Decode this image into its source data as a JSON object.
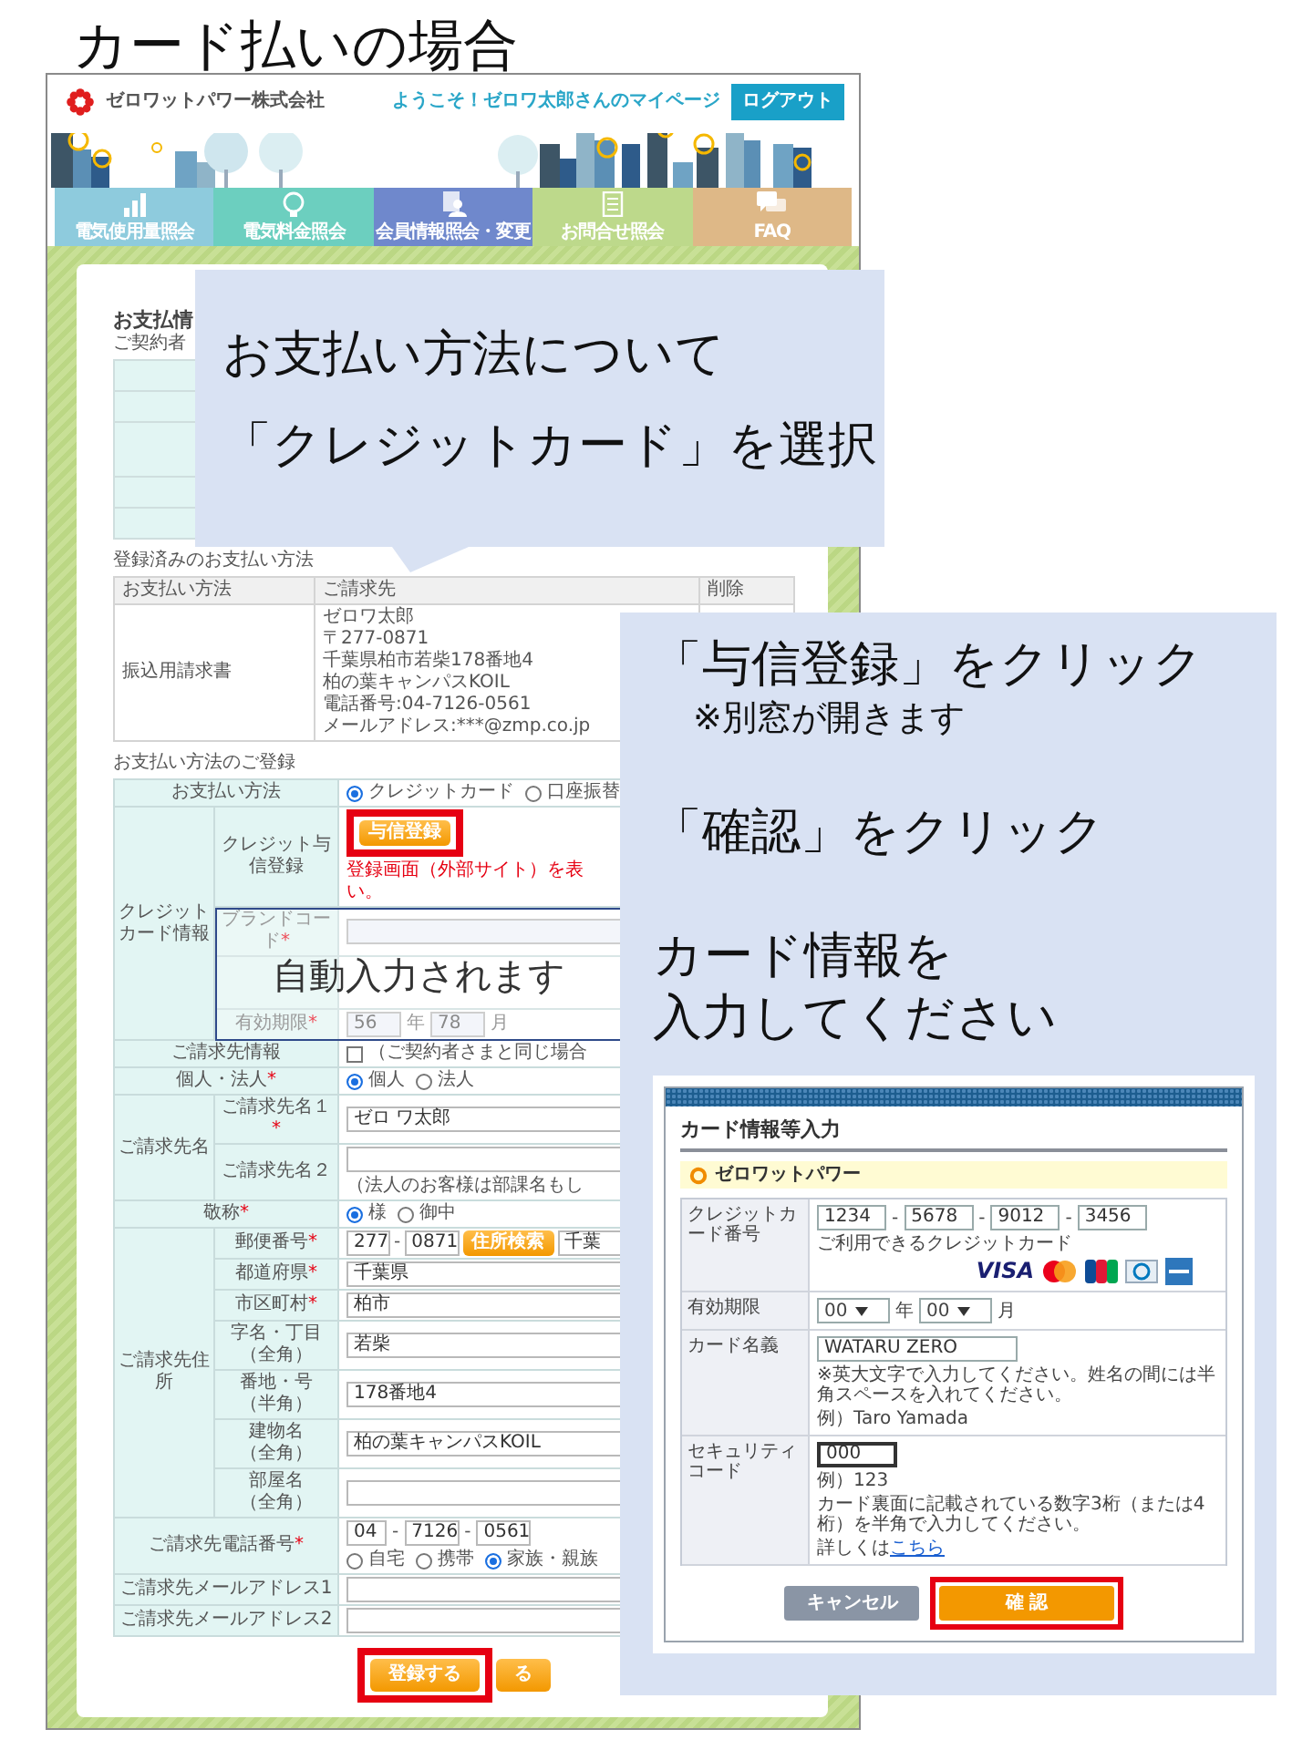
{
  "title": "カード払いの場合",
  "site": {
    "logo_text": "ゼロワットパワー株式会社",
    "welcome": "ようこそ！ゼロワ太郎さんのマイページ",
    "logout": "ログアウト",
    "nav": [
      {
        "label": "電気使用量照会",
        "color": "#8ecbdd",
        "kind": "chart"
      },
      {
        "label": "電気料金照会",
        "color": "#6ccfbf",
        "kind": "bulb"
      },
      {
        "label": "会員情報照会・変更",
        "color": "#6f88cc",
        "kind": "member"
      },
      {
        "label": "お問合せ照会",
        "color": "#bdd98b",
        "kind": "document"
      },
      {
        "label": "FAQ",
        "color": "#deb887",
        "kind": "chat"
      }
    ],
    "page_title": "お支払情",
    "page_subtitle": "ご契約者",
    "registered": {
      "label": "登録済みのお支払い方法",
      "columns": [
        "お支払い方法",
        "ご請求先",
        "削除"
      ],
      "rows": [
        {
          "method": "振込用請求書",
          "lines": [
            "ゼロワ太郎",
            "〒277-0871",
            "千葉県柏市若柴178番地4",
            "柏の葉キャンパスKOIL",
            "電話番号:04-7126-0561",
            "メールアドレス:***@zmp.co.jp"
          ]
        }
      ]
    },
    "registration": {
      "label": "お支払い方法のご登録",
      "auto_fill_note": "自動入力されます",
      "sections": [
        {
          "label": "お支払い方法",
          "kind": "radio",
          "options": [
            {
              "label": "クレジットカード",
              "selected": true
            },
            {
              "label": "口座振替",
              "selected": false
            }
          ]
        },
        {
          "label": "クレジットカード情報",
          "rows": [
            {
              "label": "クレジット与信登録",
              "kind": "button",
              "button": "与信登録",
              "highlighted": true,
              "note": [
                "登録画面（外部サイト）を表",
                "い。"
              ]
            },
            {
              "label": "ブランドコード",
              "mark": "*",
              "kind": "input",
              "disabled": true
            },
            {
              "kind": "covered"
            },
            {
              "label": "有効期限",
              "mark": "*",
              "kind": "expiry",
              "values": [
                "56",
                "78"
              ],
              "units": [
                "年",
                "月"
              ],
              "disabled": true
            }
          ]
        },
        {
          "label": "ご請求先情報",
          "kind": "check",
          "checked": false,
          "text": "（ご契約者さまと同じ場合"
        },
        {
          "label": "個人・法人",
          "mark": "*",
          "kind": "radio",
          "options": [
            {
              "label": "個人",
              "selected": true
            },
            {
              "label": "法人",
              "selected": false
            }
          ]
        },
        {
          "label": "ご請求先名",
          "rows": [
            {
              "label": "ご請求先名１",
              "mark": "*",
              "kind": "input",
              "value": "ゼロ ワ太郎"
            },
            {
              "label": "ご請求先名２",
              "kind": "input",
              "note": "（法人のお客様は部課名もし"
            }
          ]
        },
        {
          "label": "敬称",
          "mark": "*",
          "kind": "radio",
          "options": [
            {
              "label": "様",
              "selected": true
            },
            {
              "label": "御中",
              "selected": false
            }
          ]
        },
        {
          "label": "ご請求先住所",
          "rows": [
            {
              "label": "郵便番号",
              "mark": "*",
              "kind": "postal",
              "values": [
                "277",
                "0871"
              ],
              "separator": "-",
              "button": "住所検索",
              "result": "千葉"
            },
            {
              "label": "都道府県",
              "mark": "*",
              "kind": "input",
              "value": "千葉県"
            },
            {
              "label": "市区町村",
              "mark": "*",
              "kind": "input",
              "value": "柏市"
            },
            {
              "label": "字名・丁目",
              "sub": "（全角）",
              "kind": "input",
              "value": "若柴"
            },
            {
              "label": "番地・号",
              "sub": "（半角）",
              "kind": "input",
              "value": "178番地4"
            },
            {
              "label": "建物名",
              "sub": "（全角）",
              "kind": "input",
              "value": "柏の葉キャンパスKOIL"
            },
            {
              "label": "部屋名",
              "sub": "（全角）",
              "kind": "input"
            }
          ]
        },
        {
          "label": "ご請求先電話番号",
          "mark": "*",
          "kind": "phone",
          "values": [
            "04",
            "7126",
            "0561"
          ],
          "separator": "-",
          "options": [
            {
              "label": "自宅",
              "selected": false
            },
            {
              "label": "携帯",
              "selected": false
            },
            {
              "label": "家族・親族",
              "selected": true
            }
          ]
        },
        {
          "label": "ご請求先メールアドレス1",
          "kind": "input"
        },
        {
          "label": "ご請求先メールアドレス2",
          "kind": "input"
        }
      ]
    },
    "buttons": [
      {
        "label": "登録する",
        "highlighted": true
      },
      {
        "label": "る",
        "highlighted": false
      }
    ]
  },
  "callouts": [
    {
      "lines": [
        "お支払い方法について",
        "「クレジットカード」を選択"
      ]
    },
    {
      "items": [
        {
          "kind": "heading",
          "text": "「与信登録」をクリック"
        },
        {
          "kind": "note",
          "text": "※別窓が開きます"
        },
        {
          "kind": "heading",
          "text": "「確認」をクリック"
        },
        {
          "kind": "heading",
          "text": "カード情報を"
        },
        {
          "kind": "continuation",
          "text": "入力してください"
        }
      ],
      "card_dialog": {
        "title": "カード情報等入力",
        "merchant": "ゼロワットパワー",
        "rows": [
          {
            "kind": "card_number",
            "label": "クレジットカード番号",
            "values": [
              "1234",
              "5678",
              "9012",
              "3456"
            ],
            "separator": "-",
            "note": "ご利用できるクレジットカード",
            "brand": "VISA"
          },
          {
            "kind": "expiry",
            "label": "有効期限",
            "values": [
              "00",
              "00"
            ],
            "units": [
              "年",
              "月"
            ]
          },
          {
            "kind": "name",
            "label": "カード名義",
            "value": "WATARU ZERO",
            "notes": [
              "※英大文字で入力してください。姓名の間には半角スペースを入れてください。",
              "例）Taro Yamada"
            ]
          },
          {
            "kind": "security",
            "label": "セキュリティコード",
            "value": "000",
            "notes": [
              "例）123",
              "カード裏面に記載されている数字3桁（または4桁）を半角で入力してください。"
            ],
            "more": "詳しくは",
            "link": "こちら"
          }
        ],
        "buttons": [
          {
            "label": "キャンセル",
            "kind": "secondary",
            "highlighted": false
          },
          {
            "label": "確 認",
            "kind": "primary",
            "highlighted": true
          }
        ]
      }
    }
  ]
}
